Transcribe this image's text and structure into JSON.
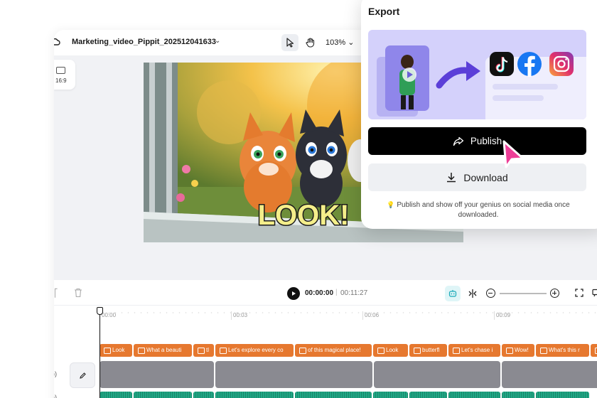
{
  "editor": {
    "project_name": "Marketing_video_Pippit_202512041633",
    "zoom_level": "103%",
    "aspect_ratio": "16:9"
  },
  "preview": {
    "caption_text": "LOOK!"
  },
  "timeline": {
    "current_time": "00:00:00",
    "separator": "|",
    "total_time": "00:11:27",
    "ticks": [
      "00:00",
      "00:03",
      "00:06",
      "00:09"
    ],
    "text_clips": [
      "Look",
      "What a beauti",
      "tl",
      "Let's explore every co",
      "of this magical place!",
      "Look",
      "butterfl",
      "Let's chase i",
      "Wow!",
      "What's this r",
      ""
    ]
  },
  "export": {
    "title": "Export",
    "publish_label": "Publish",
    "download_label": "Download",
    "hint": "Publish and show off your genius on social media once downloaded."
  },
  "colors": {
    "accent_purple": "#d4d1fb",
    "text_clip": "#e6782f",
    "audio_clip": "#21a785",
    "video_clip": "#8a8a91",
    "cursor": "#ee3d97"
  }
}
